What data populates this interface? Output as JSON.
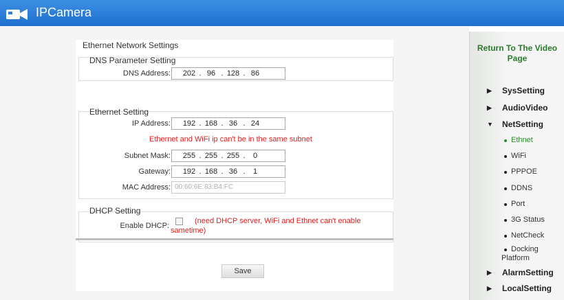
{
  "header": {
    "title": "IPCamera"
  },
  "ethernet_settings": {
    "title": "Ethernet Network Settings",
    "dns": {
      "title": "DNS Parameter Setting",
      "label": "DNS Address:",
      "octets": [
        "202",
        "96",
        "128",
        "86"
      ]
    },
    "ethernet": {
      "title": "Ethernet Setting",
      "ip_label": "IP Address:",
      "ip_octets": [
        "192",
        "168",
        "36",
        "24"
      ],
      "warning": "Ethernet and WiFi ip can't be in the same subnet",
      "mask_label": "Subnet Mask:",
      "mask_octets": [
        "255",
        "255",
        "255",
        "0"
      ],
      "gateway_label": "Gateway:",
      "gateway_octets": [
        "192",
        "168",
        "36",
        "1"
      ],
      "mac_label": "MAC Address:",
      "mac_value": "00:60:6E:83:B4:FC"
    },
    "dhcp": {
      "title": "DHCP Setting",
      "label": "Enable DHCP:",
      "checked": false,
      "note_line1": "(need DHCP server, WiFi and Ethnet can't enable",
      "note_line2": "sametime)"
    },
    "save_label": "Save"
  },
  "sidebar": {
    "return_line1": "Return To The Video",
    "return_line2": "Page",
    "sys_setting": "SysSetting",
    "audio_video": "AudioVideo",
    "net_setting": "NetSetting",
    "net_items": [
      "Ethnet",
      "WiFi",
      "PPPOE",
      "DDNS",
      "Port",
      "3G Status",
      "NetCheck"
    ],
    "docking_line1": "Docking",
    "docking_line2": "Platform",
    "alarm_setting": "AlarmSetting",
    "local_setting": "LocalSetting"
  },
  "colors": {
    "header_blue": "#2d7fdc",
    "active_green": "#2b8a2b",
    "warning_red": "#e02020"
  }
}
